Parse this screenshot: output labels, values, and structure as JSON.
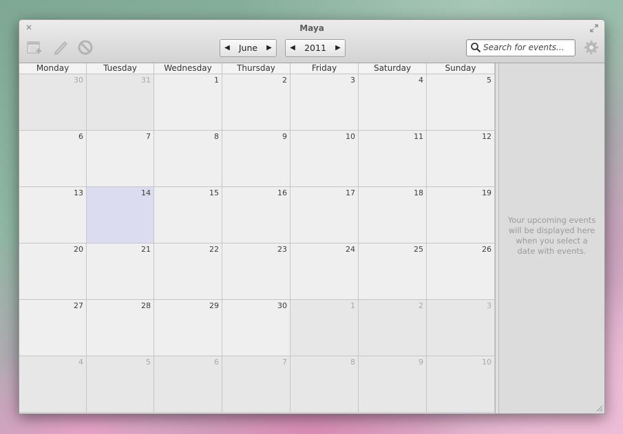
{
  "window": {
    "title": "Maya"
  },
  "toolbar": {
    "icons": [
      "add-event-icon",
      "edit-event-icon",
      "remove-event-icon"
    ],
    "month": {
      "label": "June",
      "prev": "◀",
      "next": "▶"
    },
    "year": {
      "label": "2011",
      "prev": "◀",
      "next": "▶"
    },
    "search": {
      "placeholder": "Search for events..."
    }
  },
  "calendar": {
    "weekdays": [
      "Monday",
      "Tuesday",
      "Wednesday",
      "Thursday",
      "Friday",
      "Saturday",
      "Sunday"
    ],
    "weeks": [
      [
        "30",
        "31",
        "1",
        "2",
        "3",
        "4",
        "5"
      ],
      [
        "6",
        "7",
        "8",
        "9",
        "10",
        "11",
        "12"
      ],
      [
        "13",
        "14",
        "15",
        "16",
        "17",
        "18",
        "19"
      ],
      [
        "20",
        "21",
        "22",
        "23",
        "24",
        "25",
        "26"
      ],
      [
        "27",
        "28",
        "29",
        "30",
        "1",
        "2",
        "3"
      ],
      [
        "4",
        "5",
        "6",
        "7",
        "8",
        "9",
        "10"
      ]
    ],
    "other_month": [
      [
        true,
        true,
        false,
        false,
        false,
        false,
        false
      ],
      [
        false,
        false,
        false,
        false,
        false,
        false,
        false
      ],
      [
        false,
        false,
        false,
        false,
        false,
        false,
        false
      ],
      [
        false,
        false,
        false,
        false,
        false,
        false,
        false
      ],
      [
        false,
        false,
        false,
        false,
        true,
        true,
        true
      ],
      [
        true,
        true,
        true,
        true,
        true,
        true,
        true
      ]
    ],
    "selected": {
      "week": 2,
      "day": 1
    }
  },
  "sidebar": {
    "message": "Your upcoming events will be displayed here when you select a date with events."
  },
  "colors": {
    "selected_day": "#dcdcf0",
    "other_month_text": "#a8a8a8"
  }
}
